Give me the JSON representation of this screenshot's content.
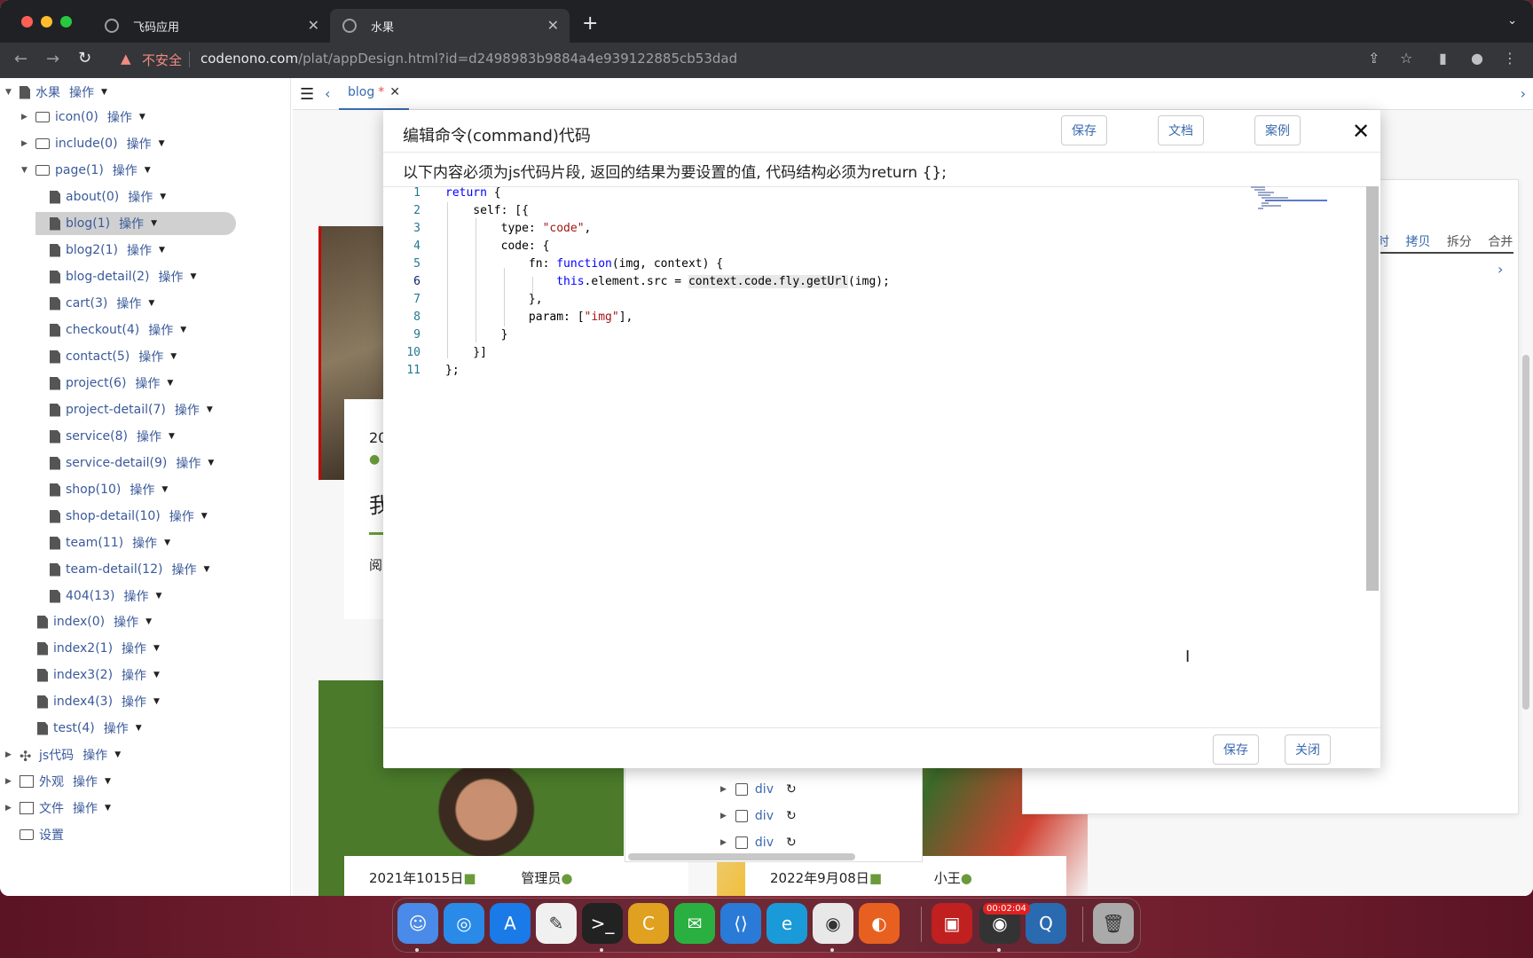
{
  "browser": {
    "tabs": [
      {
        "title": "飞码应用"
      },
      {
        "title": "水果"
      }
    ],
    "security_label": "不安全",
    "url_host": "codenono.com",
    "url_path": "/plat/appDesign.html?id=d2498983b9884a4e939122885cb53dad"
  },
  "tree": {
    "op_label": "操作",
    "root": "水果",
    "folders": [
      {
        "label": "icon(0)"
      },
      {
        "label": "include(0)"
      },
      {
        "label": "page(1)"
      }
    ],
    "pages": [
      {
        "label": "about(0)"
      },
      {
        "label": "blog(1)"
      },
      {
        "label": "blog2(1)"
      },
      {
        "label": "blog-detail(2)"
      },
      {
        "label": "cart(3)"
      },
      {
        "label": "checkout(4)"
      },
      {
        "label": "contact(5)"
      },
      {
        "label": "project(6)"
      },
      {
        "label": "project-detail(7)"
      },
      {
        "label": "service(8)"
      },
      {
        "label": "service-detail(9)"
      },
      {
        "label": "shop(10)"
      },
      {
        "label": "shop-detail(10)"
      },
      {
        "label": "team(11)"
      },
      {
        "label": "team-detail(12)"
      },
      {
        "label": "404(13)"
      }
    ],
    "top_pages": [
      {
        "label": "index(0)"
      },
      {
        "label": "index2(1)"
      },
      {
        "label": "index3(2)"
      },
      {
        "label": "index4(3)"
      },
      {
        "label": "test(4)"
      }
    ],
    "sections": [
      {
        "label": "js代码"
      },
      {
        "label": "外观"
      },
      {
        "label": "文件"
      }
    ],
    "settings": "设置",
    "selected": "blog(1)"
  },
  "editor_tab": {
    "label": "blog",
    "dirty_mark": "*"
  },
  "preview": {
    "card1_date": "20",
    "card1_title": "我",
    "card1_read": "阅",
    "card2_date": "2021年1015日",
    "card2_author": "管理员",
    "card3_date": "2022年9月08日",
    "card3_author": "小王"
  },
  "dom_tree": {
    "rows": [
      {
        "label": "div"
      },
      {
        "label": "div"
      },
      {
        "label": "div"
      }
    ]
  },
  "right_panel": {
    "tabs": [
      "时",
      "拷贝",
      "拆分",
      "合并"
    ]
  },
  "modal": {
    "title": "编辑命令(command)代码",
    "save_label": "保存",
    "docs_label": "文档",
    "examples_label": "案例",
    "close_icon": "✕",
    "description": "以下内容必须为js代码片段, 返回的结果为要设置的值, 代码结构必须为return {};",
    "footer_save_label": "保存",
    "footer_close_label": "关闭",
    "code_lines": [
      "return {",
      "    self: [{",
      "        type: \"code\",",
      "        code: {",
      "            fn: function(img, context) {",
      "                this.element.src = context.code.fly.getUrl(img);",
      "            },",
      "            param: [\"img\"],",
      "        }",
      "    }]",
      "};"
    ],
    "active_line": 6
  },
  "dock": {
    "timer_badge": "00:02:04",
    "apps": [
      "finder-icon",
      "safari-icon",
      "app-store-icon",
      "textedit-icon",
      "terminal-icon",
      "clion-icon",
      "wechat-icon",
      "vscode-icon",
      "edge-icon",
      "chrome-icon",
      "firefox-icon",
      "parallels-icon",
      "screen-recorder-icon",
      "quicktime-icon",
      "trash-icon"
    ]
  },
  "colors": {
    "accent": "#3a6ab0",
    "chrome_dark": "#202124",
    "toolbar": "#35363a",
    "warning": "#f28b82",
    "keyword": "#0000ff",
    "string": "#a31515"
  }
}
